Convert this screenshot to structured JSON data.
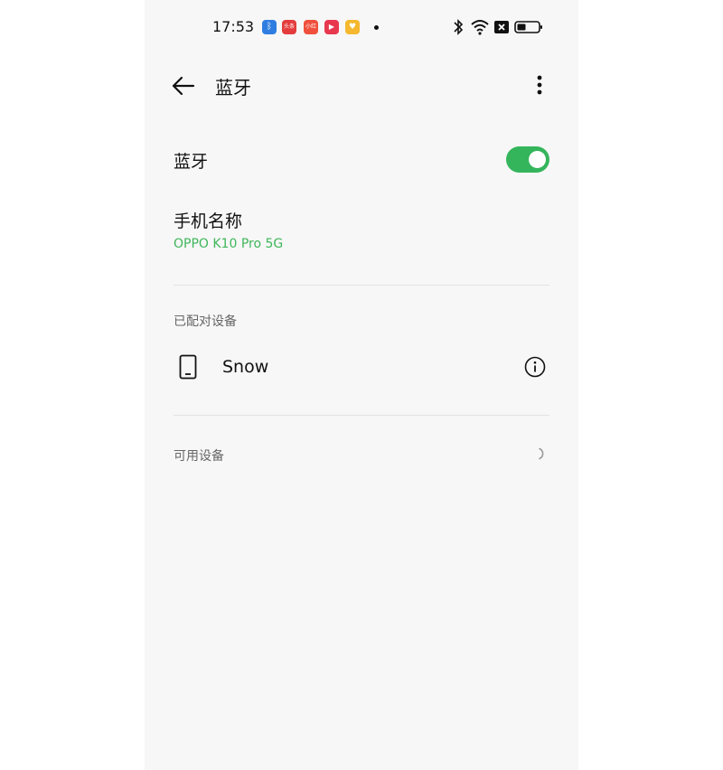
{
  "status_bar": {
    "time": "17:53",
    "notification_icons": [
      {
        "name": "bluetooth-app-icon",
        "color": "#2f7de1",
        "text": "ᛒ"
      },
      {
        "name": "toutiao-app-icon",
        "color": "#e43c3c",
        "text": "头条"
      },
      {
        "name": "shopping-app-icon",
        "color": "#f0503c",
        "text": "小红书"
      },
      {
        "name": "video-app-icon",
        "color": "#e8384f",
        "text": "▶"
      },
      {
        "name": "coupon-app-icon",
        "color": "#f5b82e",
        "text": "♥"
      }
    ]
  },
  "app_bar": {
    "title": "蓝牙"
  },
  "bluetooth_toggle": {
    "label": "蓝牙",
    "on": true,
    "color": "#34b55c"
  },
  "phone_name": {
    "label": "手机名称",
    "value": "OPPO K10 Pro 5G",
    "value_color": "#3fb65a"
  },
  "paired_devices": {
    "header": "已配对设备",
    "items": [
      {
        "name": "Snow",
        "icon": "phone-icon"
      }
    ]
  },
  "available_devices": {
    "header": "可用设备"
  }
}
